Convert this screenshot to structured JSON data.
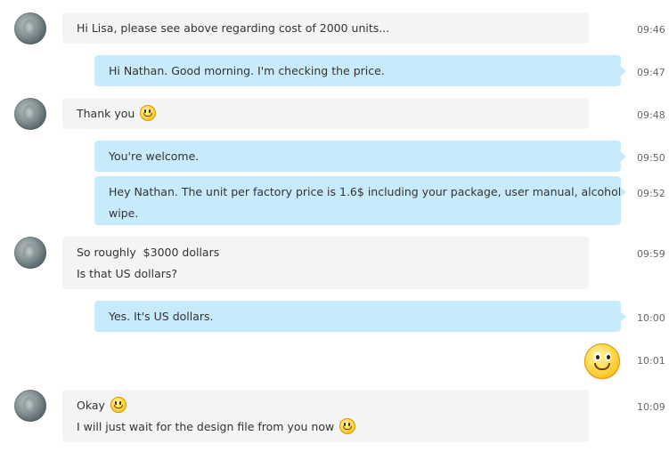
{
  "messages": [
    {
      "id": "m1",
      "from": "Nathan",
      "direction": "in",
      "lines": [
        "Hi Lisa, please see above regarding cost of 2000 units..."
      ],
      "time": "09:46"
    },
    {
      "id": "m2",
      "from": "Lisa",
      "direction": "out",
      "lines": [
        "Hi Nathan. Good morning. I'm checking the price."
      ],
      "time": "09:47"
    },
    {
      "id": "m3",
      "from": "Nathan",
      "direction": "in",
      "lines": [
        "Thank you"
      ],
      "emoji": "smile-emoji",
      "time": "09:48"
    },
    {
      "id": "m4",
      "from": "Lisa",
      "direction": "out",
      "lines": [
        "You're welcome."
      ],
      "time": "09:50"
    },
    {
      "id": "m5",
      "from": "Lisa",
      "direction": "out",
      "lines": [
        "Hey Nathan. The unit per factory price is 1.6$ including your package, user manual, alcohol",
        "wipe."
      ],
      "time": "09:52"
    },
    {
      "id": "m6",
      "from": "Nathan",
      "direction": "in",
      "lines": [
        "So roughly  $3000 dollars",
        "Is that US dollars?"
      ],
      "time": "09:59"
    },
    {
      "id": "m7",
      "from": "Lisa",
      "direction": "out",
      "lines": [
        "Yes. It's US dollars."
      ],
      "time": "10:00"
    },
    {
      "id": "m8",
      "from": "Lisa",
      "direction": "out",
      "emoji": "big-smile-emoji",
      "time": "10:01"
    },
    {
      "id": "m9",
      "from": "Nathan",
      "direction": "in",
      "lines": [
        "Okay",
        "I will just wait for the design file from you now"
      ],
      "emoji": "smile-emoji",
      "time": "10:09"
    }
  ],
  "colors": {
    "incoming_bubble": "#f2f4f6",
    "outgoing_bubble": "#c7ebfb",
    "timestamp": "#666666",
    "text": "#333333"
  }
}
